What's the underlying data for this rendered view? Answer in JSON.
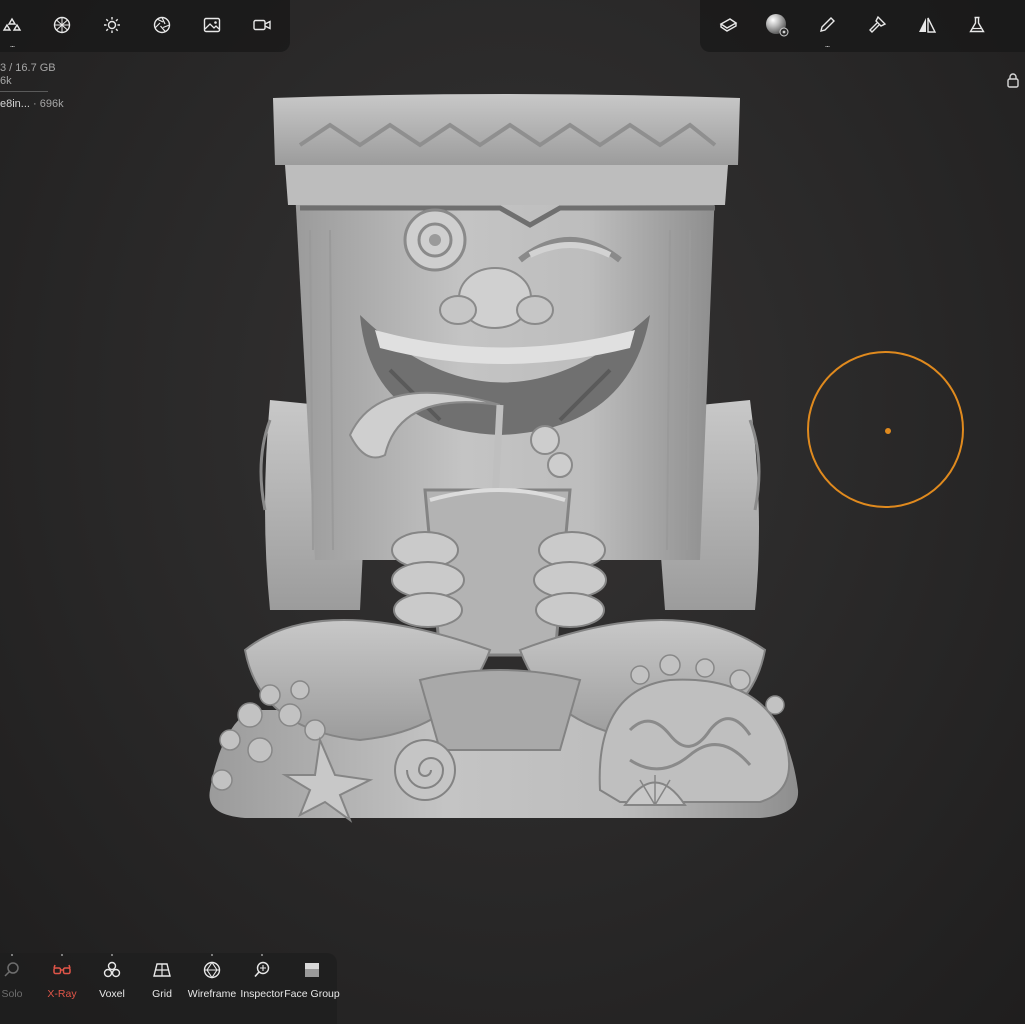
{
  "app": {
    "top_left_toolbar": [
      {
        "name": "scene-icon",
        "has_more": true
      },
      {
        "name": "topology-icon",
        "has_more": false
      },
      {
        "name": "light-icon",
        "has_more": false
      },
      {
        "name": "camera-aperture-icon",
        "has_more": false
      },
      {
        "name": "image-icon",
        "has_more": false
      },
      {
        "name": "video-icon",
        "has_more": false
      }
    ],
    "top_right_toolbar": [
      {
        "name": "layer-icon",
        "has_more": false
      },
      {
        "name": "material-sphere-icon",
        "has_more": false
      },
      {
        "name": "brush-pen-icon",
        "has_more": true
      },
      {
        "name": "paint-roller-icon",
        "has_more": false
      },
      {
        "name": "symmetry-icon",
        "has_more": false
      },
      {
        "name": "flask-icon",
        "has_more": false
      }
    ],
    "more_indicator": "...",
    "stats": {
      "memory": "3 / 16.7 GB",
      "vertices": "6k",
      "mesh_name": "e8in...",
      "mesh_faces": " · 696k"
    },
    "accent_color": "#e08a1e",
    "bottom_toolbar": [
      {
        "label": "Solo",
        "icon": "search-icon",
        "active": false,
        "dim": true
      },
      {
        "label": "X-Ray",
        "icon": "glasses-icon",
        "active": true,
        "dim": false
      },
      {
        "label": "Voxel",
        "icon": "voxel-icon",
        "active": false,
        "dim": false
      },
      {
        "label": "Grid",
        "icon": "grid-icon",
        "active": false,
        "dim": false
      },
      {
        "label": "Wireframe",
        "icon": "wireframe-icon",
        "active": false,
        "dim": false
      },
      {
        "label": "Inspector",
        "icon": "inspector-icon",
        "active": false,
        "dim": false
      },
      {
        "label": "Face Group",
        "icon": "face-group-icon",
        "active": false,
        "dim": false
      }
    ]
  }
}
